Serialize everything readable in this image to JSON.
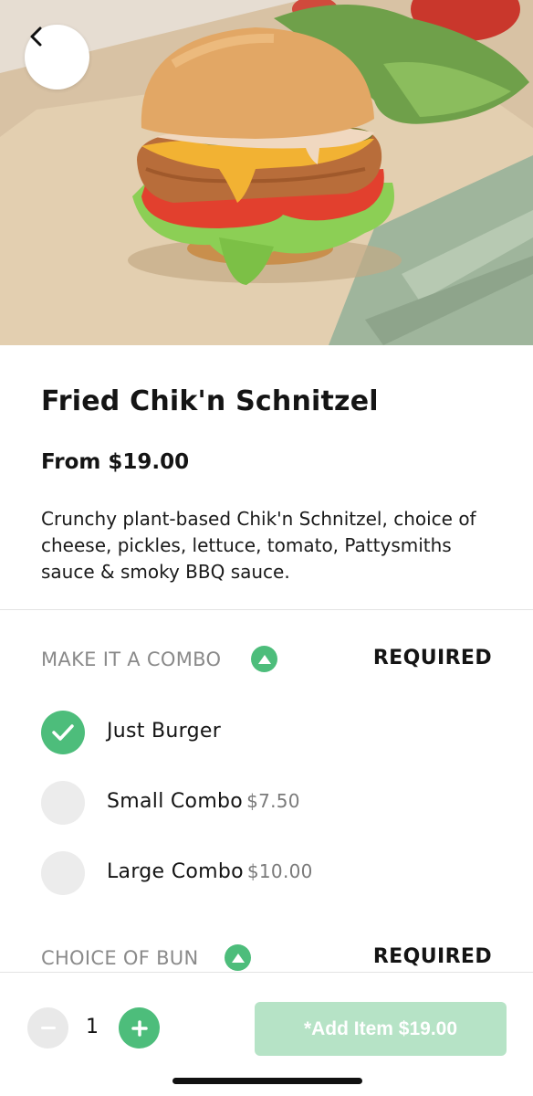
{
  "product": {
    "name": "Fried Chik'n Schnitzel",
    "price": "From $19.00",
    "description": "Crunchy plant-based Chik'n Schnitzel, choice of cheese, pickles, lettuce, tomato, Pattysmiths sauce & smoky BBQ sauce."
  },
  "nav": {
    "back_icon": "chevron-left-icon"
  },
  "sections": [
    {
      "title": "MAKE IT A COMBO",
      "badge": "REQUIRED",
      "options": [
        {
          "label": "Just Burger",
          "price": "",
          "selected": true
        },
        {
          "label": "Small Combo",
          "price": "$7.50",
          "selected": false
        },
        {
          "label": "Large Combo",
          "price": "$10.00",
          "selected": false
        }
      ]
    },
    {
      "title": "CHOICE OF BUN",
      "badge": "REQUIRED"
    }
  ],
  "cart": {
    "quantity": "1",
    "add_label": "*Add Item $19.00"
  },
  "colors": {
    "accent": "#4dbd7b",
    "add_button_disabled": "#b6e3c6",
    "muted_text": "#8a8a8a"
  }
}
